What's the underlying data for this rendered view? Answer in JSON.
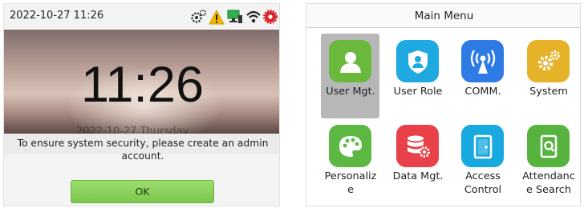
{
  "standby": {
    "datetime": "2022-10-27 11:26",
    "clock": "11:26",
    "date_line": "2022-10-27    Thursday",
    "status_icons": [
      "settings-gear-icon",
      "warning-triangle-icon",
      "network-monitor-icon",
      "wifi-icon",
      "red-settings-icon"
    ],
    "dialog": {
      "message": "To ensure system security, please create an admin\naccount.",
      "ok_label": "OK"
    }
  },
  "menu": {
    "title": "Main Menu",
    "selected": "User Mgt.",
    "items": [
      {
        "label": "User Mgt.",
        "icon": "person-icon",
        "color": "#6ab93c"
      },
      {
        "label": "User Role",
        "icon": "shield-user-icon",
        "color": "#1ea9e1"
      },
      {
        "label": "COMM.",
        "icon": "antenna-signal-icon",
        "color": "#2f7be5"
      },
      {
        "label": "System",
        "icon": "gears-icon",
        "color": "#e6b228"
      },
      {
        "label": "Personaliz\ne",
        "icon": "palette-icon",
        "color": "#5cb842"
      },
      {
        "label": "Data Mgt.",
        "icon": "database-gear-icon",
        "color": "#e8414a"
      },
      {
        "label": "Access\nControl",
        "icon": "door-icon",
        "color": "#17a9df"
      },
      {
        "label": "Attendanc\ne Search",
        "icon": "search-document-icon",
        "color": "#55b33e"
      }
    ]
  },
  "colors": {
    "ok_button": "#86cf55",
    "selected_tile": "#b7b7b7"
  }
}
